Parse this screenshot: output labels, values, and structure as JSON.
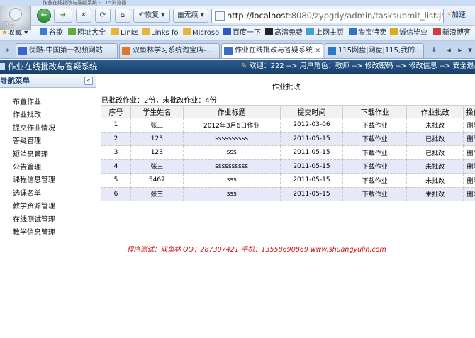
{
  "browser": {
    "window_title": "作业在线批改与答疑系统 - 115浏览器",
    "logo_text": "演示",
    "forward_label": "➜",
    "restore_label": "恢复",
    "nohistory_label": "无痕",
    "url_host": "http://localhost",
    "url_rest": ":8080/zypgdy/admin/tasksubmit_list.js",
    "accelerate_label": "加速",
    "favorites_label": "收藏",
    "favorites": [
      {
        "label": "谷歌",
        "color": "#3a7be0"
      },
      {
        "label": "网址大全",
        "color": "#5fae3b"
      },
      {
        "label": "Links",
        "color": "#e8b53c"
      },
      {
        "label": "Links fo",
        "color": "#e8b53c"
      },
      {
        "label": "Microso",
        "color": "#e8b53c"
      },
      {
        "label": "百度一下",
        "color": "#2d57c9"
      },
      {
        "label": "高清免费",
        "color": "#222222"
      },
      {
        "label": "上网主页",
        "color": "#3ea1d8"
      },
      {
        "label": "淘宝特卖",
        "color": "#3672c4"
      },
      {
        "label": "诚信毕业",
        "color": "#e0a81b"
      },
      {
        "label": "新浪博客",
        "color": "#d43b3b"
      }
    ],
    "tabs": [
      {
        "label": "优酷-中国第一视频网站...",
        "color": "#3a63d1"
      },
      {
        "label": "双鱼林学习系统淘宝店-...",
        "color": "#e0762a"
      },
      {
        "label": "作业在线批改与答疑系统",
        "color": "#3a6fc4"
      },
      {
        "label": "115网盘|网盘|115,我的...",
        "color": "#2a78c8"
      }
    ]
  },
  "header": {
    "system_title": "作业在线批改与答疑系统",
    "welcome": "欢迎：222 --> 用户角色：教师 -->",
    "change_password": "修改密码",
    "arrow1": "-->",
    "change_info": "修改信息",
    "arrow2": "-->",
    "logout": "安全退出"
  },
  "sidebar": {
    "title": "导航菜单",
    "collapse_icon": "«",
    "items": [
      {
        "label": "布置作业"
      },
      {
        "label": "作业批改"
      },
      {
        "label": "提交作业情况"
      },
      {
        "label": "答疑管理"
      },
      {
        "label": "短消息管理"
      },
      {
        "label": "公告管理"
      },
      {
        "label": "课程信息管理"
      },
      {
        "label": "选课名单"
      },
      {
        "label": "教学资源管理"
      },
      {
        "label": "在线测试管理"
      },
      {
        "label": "教学信息管理"
      }
    ]
  },
  "main": {
    "page_title": "作业批改",
    "summary": "已批改作业：2份，未批改作业：4份",
    "columns": [
      "序号",
      "学生姓名",
      "作业标题",
      "提交时间",
      "下载作业",
      "作业批改",
      "操作"
    ],
    "rows": [
      {
        "no": "1",
        "student": "张三",
        "title": "2012年3月6日作业",
        "time": "2012-03-06",
        "download": "下载作业",
        "status": "未批改",
        "action": "删除"
      },
      {
        "no": "2",
        "student": "123",
        "title": "ssssssssss",
        "time": "2011-05-15",
        "download": "下载作业",
        "status": "已批改",
        "action": "删除"
      },
      {
        "no": "3",
        "student": "123",
        "title": "sss",
        "time": "2011-05-15",
        "download": "下载作业",
        "status": "已批改",
        "action": "删除"
      },
      {
        "no": "4",
        "student": "张三",
        "title": "ssssssssss",
        "time": "2011-05-15",
        "download": "下载作业",
        "status": "未批改",
        "action": "删除"
      },
      {
        "no": "5",
        "student": "5467",
        "title": "sss",
        "time": "2011-05-15",
        "download": "下载作业",
        "status": "未批改",
        "action": "删除"
      },
      {
        "no": "6",
        "student": "张三",
        "title": "sss",
        "time": "2011-05-15",
        "download": "下载作业",
        "status": "未批改",
        "action": "删除"
      }
    ],
    "credit": "程序测试：双鱼林  QQ：287307421  手机：13558690869  www.shuangyulin.com"
  }
}
